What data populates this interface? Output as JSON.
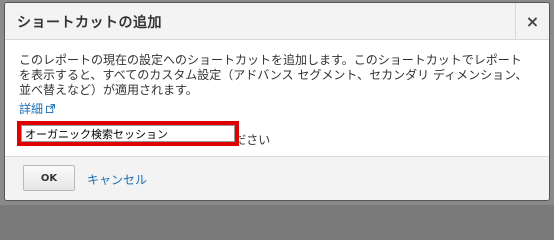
{
  "dialog": {
    "title": "ショートカットの追加",
    "close_label": "×",
    "description": "このレポートの現在の設定へのショートカットを追加します。このショートカットでレポートを表示すると、すべてのカスタム設定（アドバンス セグメント、セカンダリ ディメンション、並べ替えなど）が適用されます。",
    "details_link": "詳細",
    "name_label": "このショートカットの名前を入力してください",
    "name_value": "オーガニック検索セッション",
    "ok_label": "OK",
    "cancel_label": "キャンセル"
  },
  "colors": {
    "highlight": "#e00000",
    "link": "#1a6db3"
  },
  "icons": {
    "close": "close-icon",
    "external": "external-link-icon"
  }
}
